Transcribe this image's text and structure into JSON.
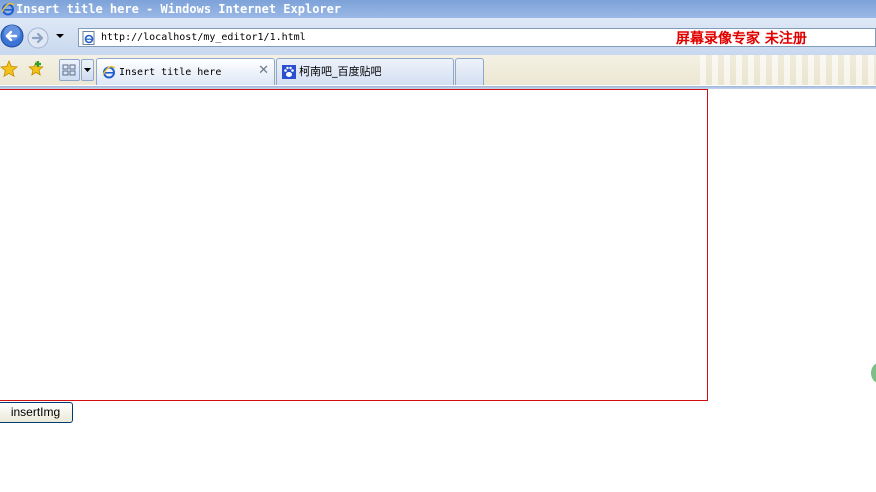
{
  "window": {
    "title": "Insert title here - Windows Internet Explorer"
  },
  "nav": {
    "back_icon": "back-arrow-icon",
    "forward_icon": "forward-arrow-icon",
    "address": "http://localhost/my_editor1/1.html"
  },
  "watermark": {
    "text": "屏幕录像专家  未注册",
    "color": "#e00000"
  },
  "tabs": [
    {
      "label": "Insert title here",
      "icon": "ie-page-icon",
      "active": true
    },
    {
      "label": "柯南吧_百度贴吧",
      "icon": "baidu-paw-icon",
      "active": false
    }
  ],
  "content": {
    "editor_border_color": "#d01010",
    "insert_button_label": "insertImg"
  }
}
